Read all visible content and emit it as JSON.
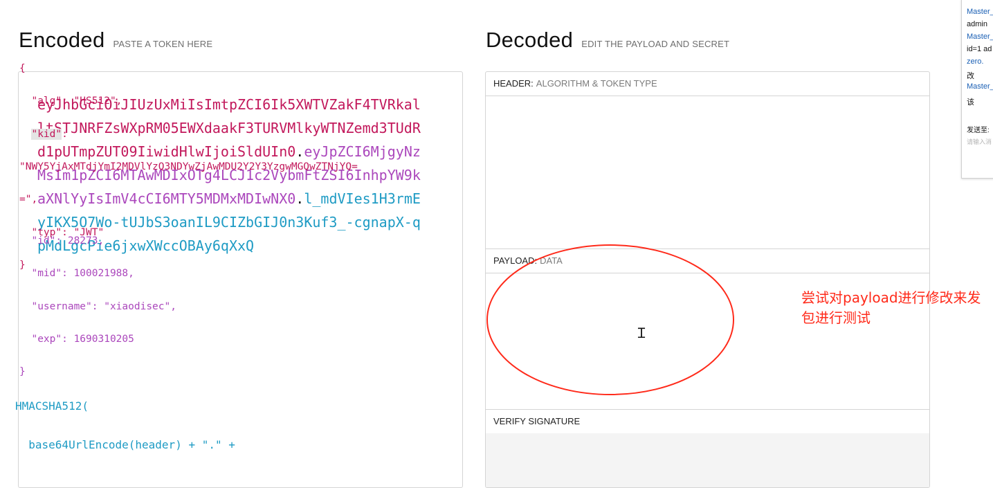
{
  "encoded": {
    "title": "Encoded",
    "subtitle": "PASTE A TOKEN HERE",
    "token_header": "eyJhbGciOiJIUzUxMiIsImtpZCI6Ik5XWTVZakF4TVRkalltSTJNRFZsWXpRM05EWXdaakF3TURVMlkyWTNZemd3TUdRd1pUTmpZUT09IiwidHlwIjoiSldUIn0",
    "dot1": ".",
    "token_payload": "eyJpZCI6MjgyNzMsIm1pZCI6MTAwMDIxOTg4LCJ1c2VybmFtZSI6InhpYW9kaXNlYyIsImV4cCI6MTY5MDMxMDIwNX0",
    "dot2": ".",
    "token_signature": "l_mdVIes1H3rmEyIKX5O7Wo-tUJbS3oanIL9CIZbGIJ0n3Kuf3_-cgnapX-qpMdLgcPie6jxwXWccOBAy6qXxQ"
  },
  "decoded": {
    "title": "Decoded",
    "subtitle": "EDIT THE PAYLOAD AND SECRET",
    "header_label": "HEADER:",
    "header_desc": "ALGORITHM & TOKEN TYPE",
    "header_lines": [
      "{",
      "  \"alg\": \"HS512\",",
      "  \"kid\":",
      "\"NWY5YjAxMTdjYmI2MDVlYzQ3NDYwZjAwMDU2Y2Y3YzgwMGQwZTNjYQ=",
      "=\",",
      "  \"typ\": \"JWT\"",
      "}"
    ],
    "payload_label": "PAYLOAD:",
    "payload_desc": "DATA",
    "payload_lines": [
      "  \"id\": 28273,",
      "  \"mid\": 100021988,",
      "  \"username\": \"xiaodisec\",",
      "  \"exp\": 1690310205",
      "}"
    ],
    "verify_label": "VERIFY SIGNATURE",
    "verify_lines": [
      "HMACSHA512(",
      "  base64UrlEncode(header) + \".\" +"
    ]
  },
  "annotation": "尝试对payload进行修改来发包进行测试",
  "side_popup": {
    "items": [
      "Master_",
      "admin",
      "Master_",
      "id=1 ad",
      "zero.",
      "改",
      "Master_",
      "该"
    ],
    "send_to": "发送至:",
    "input_placeholder": "请输入消"
  },
  "colors": {
    "header": "#c2185b",
    "payload": "#ab47bc",
    "signature": "#1e9bc4",
    "annotation": "#ff2a1a"
  }
}
